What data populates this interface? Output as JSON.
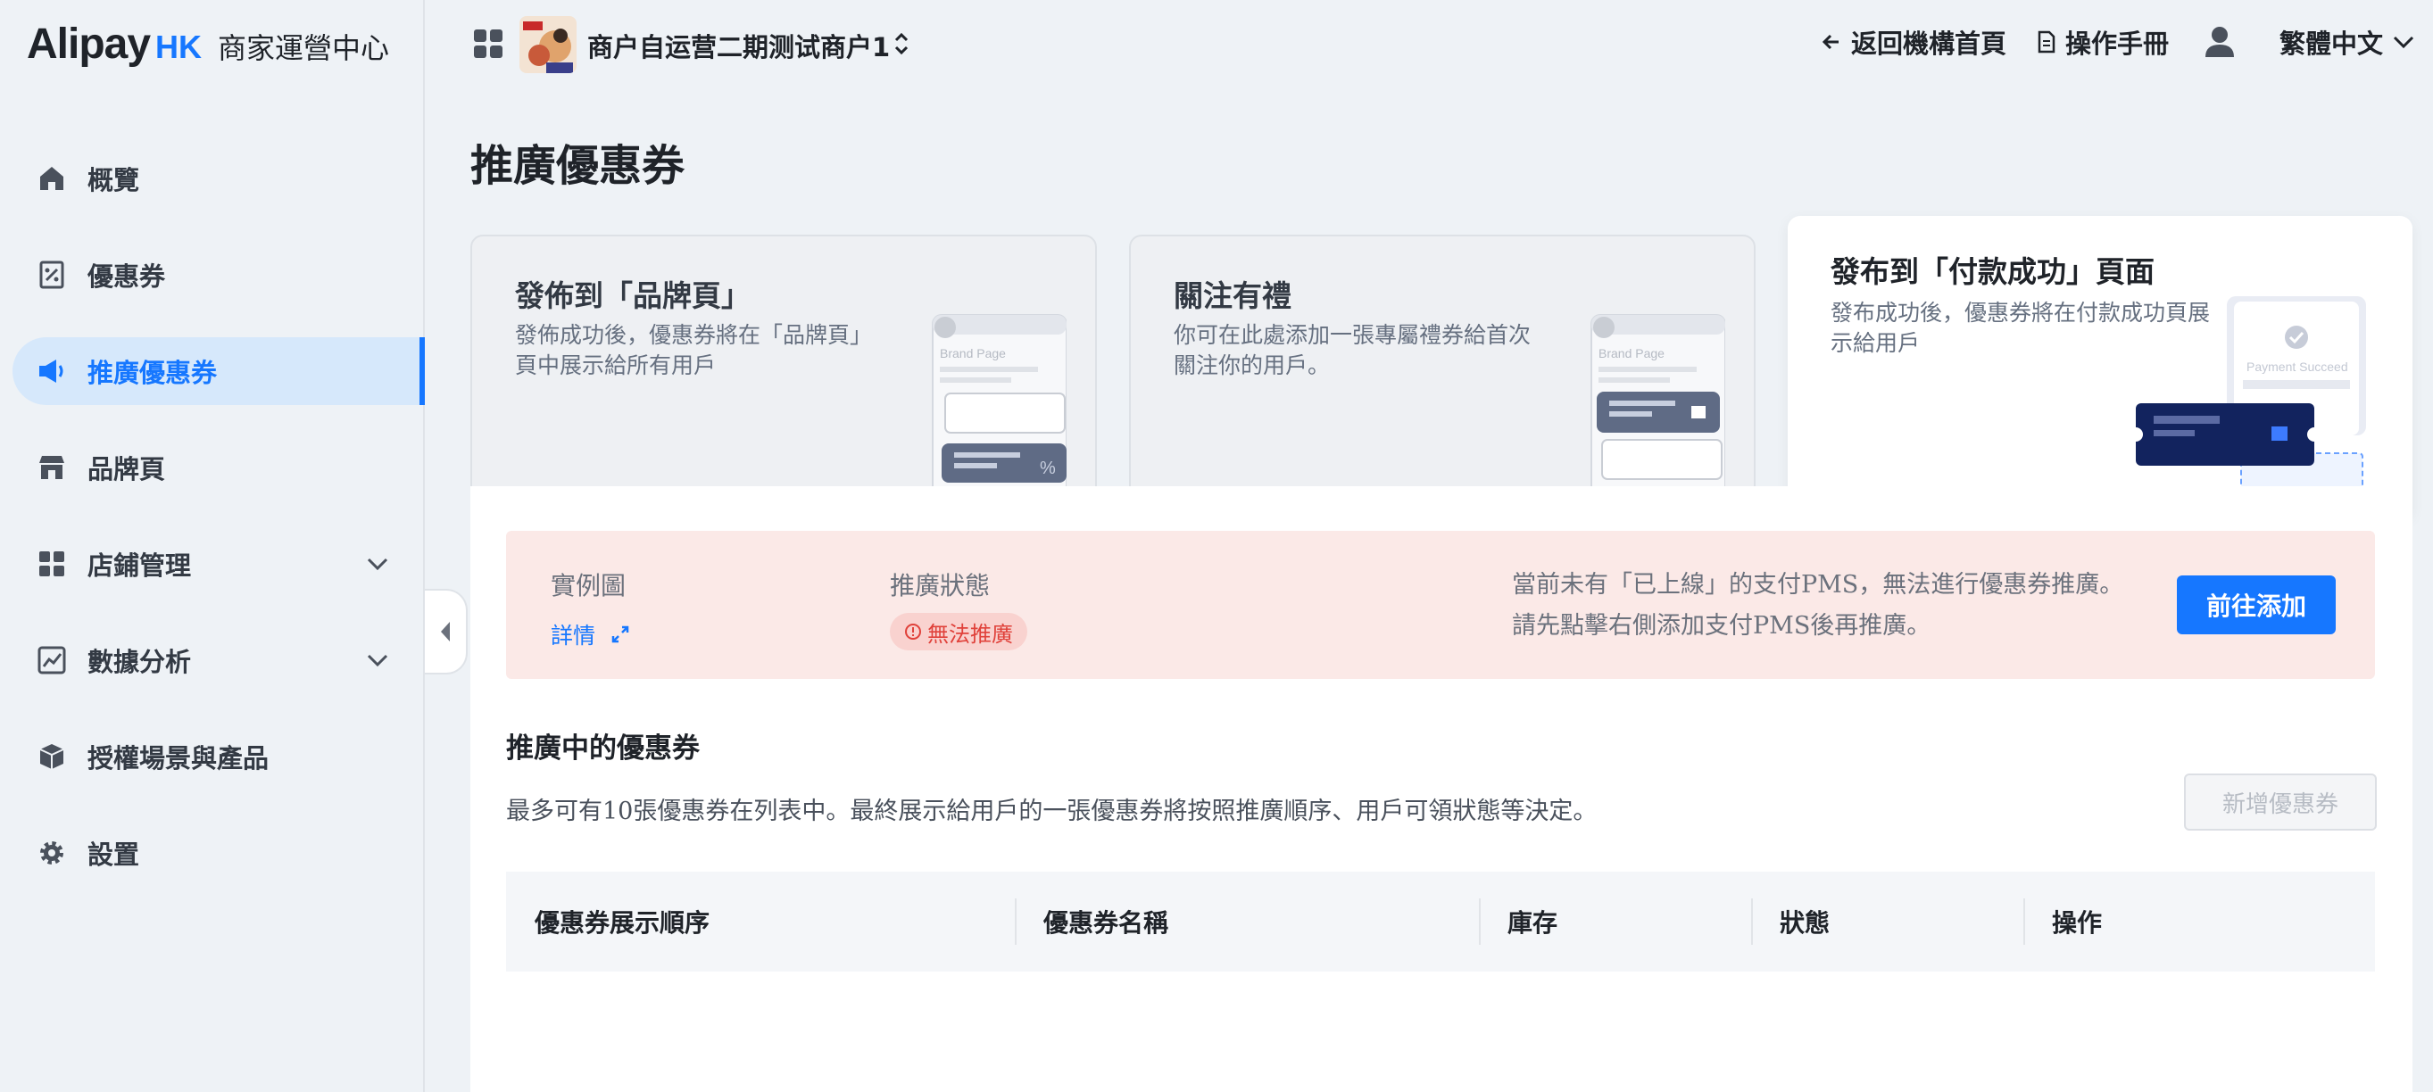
{
  "brand": {
    "name": "Alipay",
    "region": "HK",
    "subtitle": "商家運營中心"
  },
  "sidebar": {
    "items": [
      {
        "label": "概覽",
        "icon": "home-icon"
      },
      {
        "label": "優惠券",
        "icon": "coupon-icon"
      },
      {
        "label": "推廣優惠券",
        "icon": "megaphone-icon",
        "active": true
      },
      {
        "label": "品牌頁",
        "icon": "store-icon"
      },
      {
        "label": "店鋪管理",
        "icon": "grid-icon",
        "expandable": true
      },
      {
        "label": "數據分析",
        "icon": "chart-icon",
        "expandable": true
      },
      {
        "label": "授權場景與產品",
        "icon": "box-icon"
      },
      {
        "label": "設置",
        "icon": "gear-icon"
      }
    ]
  },
  "header": {
    "merchant_name": "商户自运营二期测试商户1",
    "back_label": "返回機構首頁",
    "manual_label": "操作手冊",
    "language_label": "繁體中文"
  },
  "page": {
    "title": "推廣優惠券"
  },
  "cards": [
    {
      "title": "發佈到「品牌頁」",
      "desc": "發佈成功後，優惠券將在「品牌頁」頁中展示給所有用戶",
      "illu_text": "Brand Page"
    },
    {
      "title": "關注有禮",
      "desc": "你可在此處添加一張專屬禮券給首次關注你的用戶。",
      "illu_text": "Brand Page"
    },
    {
      "title": "發布到「付款成功」頁面",
      "desc": "發布成功後，優惠券將在付款成功頁展示給用戶",
      "illu_text": "Payment Succeed"
    }
  ],
  "alert": {
    "example_label": "實例圖",
    "detail_link": "詳情",
    "status_label": "推廣狀態",
    "status_value": "無法推廣",
    "message_line1": "當前未有「已上線」的支付PMS，無法進行優惠券推廣。",
    "message_line2": "請先點擊右側添加支付PMS後再推廣。",
    "action_button": "前往添加"
  },
  "section": {
    "title": "推廣中的優惠券",
    "desc": "最多可有10張優惠券在列表中。最終展示給用戶的一張優惠券將按照推廣順序、用戶可領狀態等決定。",
    "add_button": "新增優惠券"
  },
  "table": {
    "columns": [
      "優惠券展示順序",
      "優惠券名稱",
      "庫存",
      "狀態",
      "操作"
    ]
  },
  "colors": {
    "accent": "#1677ff",
    "error": "#e0413a",
    "alert_bg": "#fbe9e7"
  }
}
